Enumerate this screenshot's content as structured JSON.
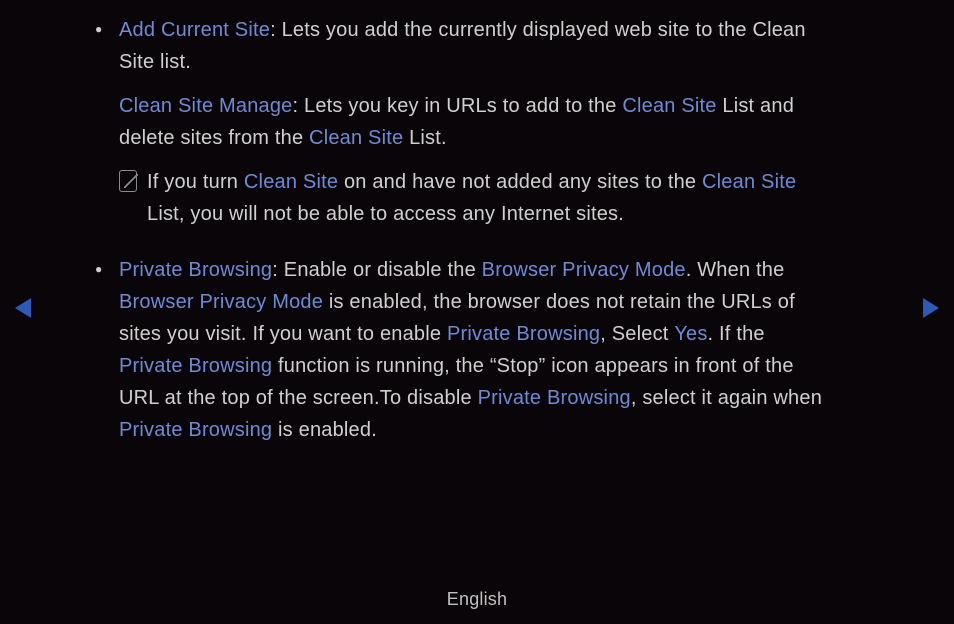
{
  "footer": {
    "language": "English"
  },
  "items": [
    {
      "para1": {
        "term": "Add Current Site",
        "text_after": ": Lets you add the currently displayed web site to the Clean Site list."
      },
      "para2": {
        "term": "Clean Site Manage",
        "t1": ": Lets you key in URLs to add to the ",
        "term2": "Clean Site",
        "t2": " List and delete sites from the ",
        "term3": "Clean Site",
        "t3": " List."
      },
      "note": {
        "t1": "If you turn ",
        "term1": "Clean Site",
        "t2": " on and have not added any sites to the ",
        "term2": "Clean Site",
        "t3": " List, you will not be able to access any Internet sites."
      }
    },
    {
      "p": {
        "term1": "Private Browsing",
        "t1": ": Enable or disable the ",
        "term2": "Browser Privacy Mode",
        "t2": ". When the ",
        "term3": "Browser Privacy Mode",
        "t3": " is enabled, the browser does not retain the URLs of sites you visit. If you want to enable ",
        "term4": "Private Browsing",
        "t4": ", Select ",
        "term5": "Yes",
        "t5": ". If the ",
        "term6": "Private Browsing",
        "t6": " function is running, the “Stop” icon appears in front of the URL at the top of the screen.To disable ",
        "term7": "Private Browsing",
        "t7": ", select it again when ",
        "term8": "Private Browsing",
        "t8": " is enabled."
      }
    }
  ]
}
